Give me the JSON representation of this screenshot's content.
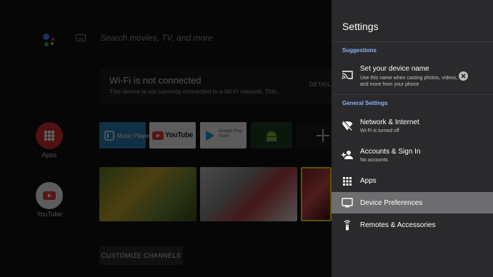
{
  "home": {
    "search_placeholder": "Search movies, TV, and more",
    "wifi_card": {
      "title": "Wi-Fi is not connected",
      "subtitle": "This device is not currently connected to a Wi-Fi network. This...",
      "action": "DETAILS"
    },
    "side_apps": [
      {
        "label": "Apps",
        "icon": "apps-grid-icon",
        "color": "#e53935"
      },
      {
        "label": "YouTube",
        "icon": "youtube-icon",
        "color": "#ffffff"
      }
    ],
    "app_row": [
      {
        "label": "Music Player",
        "icon": "music-player-icon",
        "color": "#2a7fb8"
      },
      {
        "label": "YouTube",
        "icon": "youtube-logo-icon",
        "color": "#f1f1f1"
      },
      {
        "label": "Google Play Store",
        "icon": "play-store-icon",
        "color": "#eeeeee"
      },
      {
        "label": "",
        "icon": "android-icon",
        "color": "#2e7d32"
      },
      {
        "label": "",
        "icon": "add-icon",
        "color": "#1a1a1a"
      }
    ],
    "customize_label": "CUSTOMIZE CHANNELS"
  },
  "settings": {
    "title": "Settings",
    "suggestions_header": "Suggestions",
    "suggestion": {
      "title": "Set your device name",
      "subtitle_line1": "Use this name when casting photos, videos,",
      "subtitle_line2": "and more from your phone",
      "icon": "cast-icon",
      "dismiss_icon": "close-circle-icon"
    },
    "general_header": "General Settings",
    "items": [
      {
        "title": "Network & Internet",
        "subtitle": "Wi-Fi is turned off",
        "icon": "wifi-off-icon",
        "selected": false
      },
      {
        "title": "Accounts & Sign In",
        "subtitle": "No accounts",
        "icon": "add-account-icon",
        "selected": false
      },
      {
        "title": "Apps",
        "subtitle": "",
        "icon": "apps-icon",
        "selected": false
      },
      {
        "title": "Device Preferences",
        "subtitle": "",
        "icon": "tv-icon",
        "selected": true
      },
      {
        "title": "Remotes & Accessories",
        "subtitle": "",
        "icon": "remote-icon",
        "selected": false
      }
    ],
    "colors": {
      "panel": "#2a2a2c",
      "selected": "#6e6e70",
      "section_header": "#8ab4f8"
    }
  }
}
